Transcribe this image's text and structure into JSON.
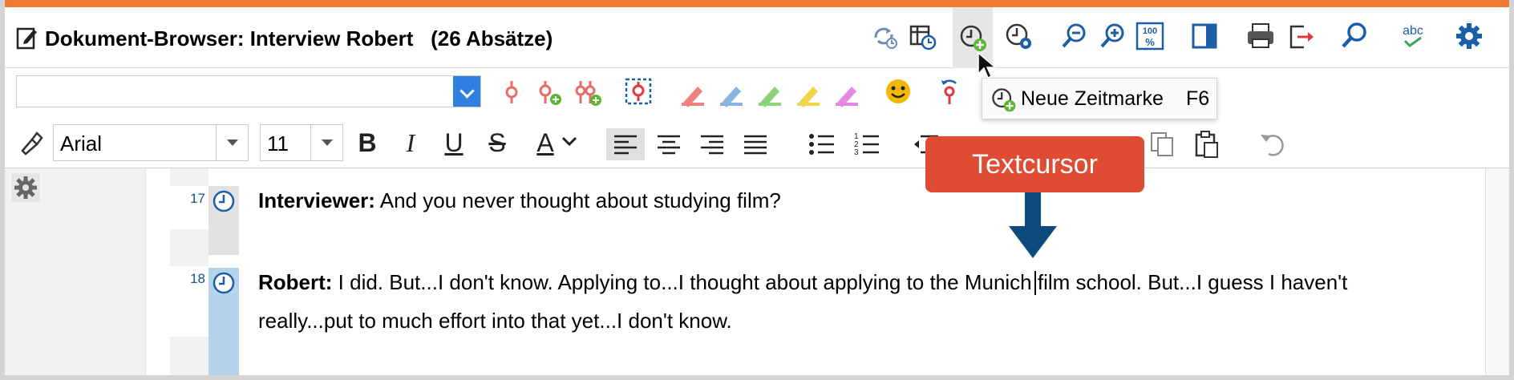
{
  "title": {
    "text": "Dokument-Browser: Interview Robert   (26 Absätze)"
  },
  "toolbar_top": {
    "icons": [
      "refresh-icon",
      "table-clock-icon",
      "new-timestamp-icon",
      "timestamp-settings-icon",
      "zoom-out-icon",
      "zoom-in-icon",
      "zoom-100-icon",
      "panel-toggle-icon",
      "print-icon",
      "export-icon",
      "search-icon",
      "spellcheck-icon",
      "settings-gear-icon"
    ]
  },
  "code_combo": {
    "value": ""
  },
  "format": {
    "font": "Arial",
    "size": "11",
    "bold": "B",
    "italic": "I",
    "underline": "U",
    "strike": "S",
    "font_color": "A"
  },
  "tooltip": {
    "label": "Neue Zeitmarke",
    "shortcut": "F6"
  },
  "callout": {
    "text": "Textcursor"
  },
  "paragraphs": [
    {
      "number": "17",
      "speaker": "Interviewer:",
      "line1": " And you never thought about studying film?",
      "line2": ""
    },
    {
      "number": "18",
      "speaker": "Robert:",
      "line1": " I did. But...I don't know. Applying to...I thought about applying to the Munich film school. But...I guess I haven't",
      "line2": "really...put to much effort into that yet...I don't know."
    }
  ],
  "colors": {
    "accent_orange": "#f07a31",
    "callout_red": "#e04b33",
    "arrow_blue": "#0d4a7e",
    "icon_blue": "#1a5fa8",
    "selected_para": "#b5d3ea"
  }
}
